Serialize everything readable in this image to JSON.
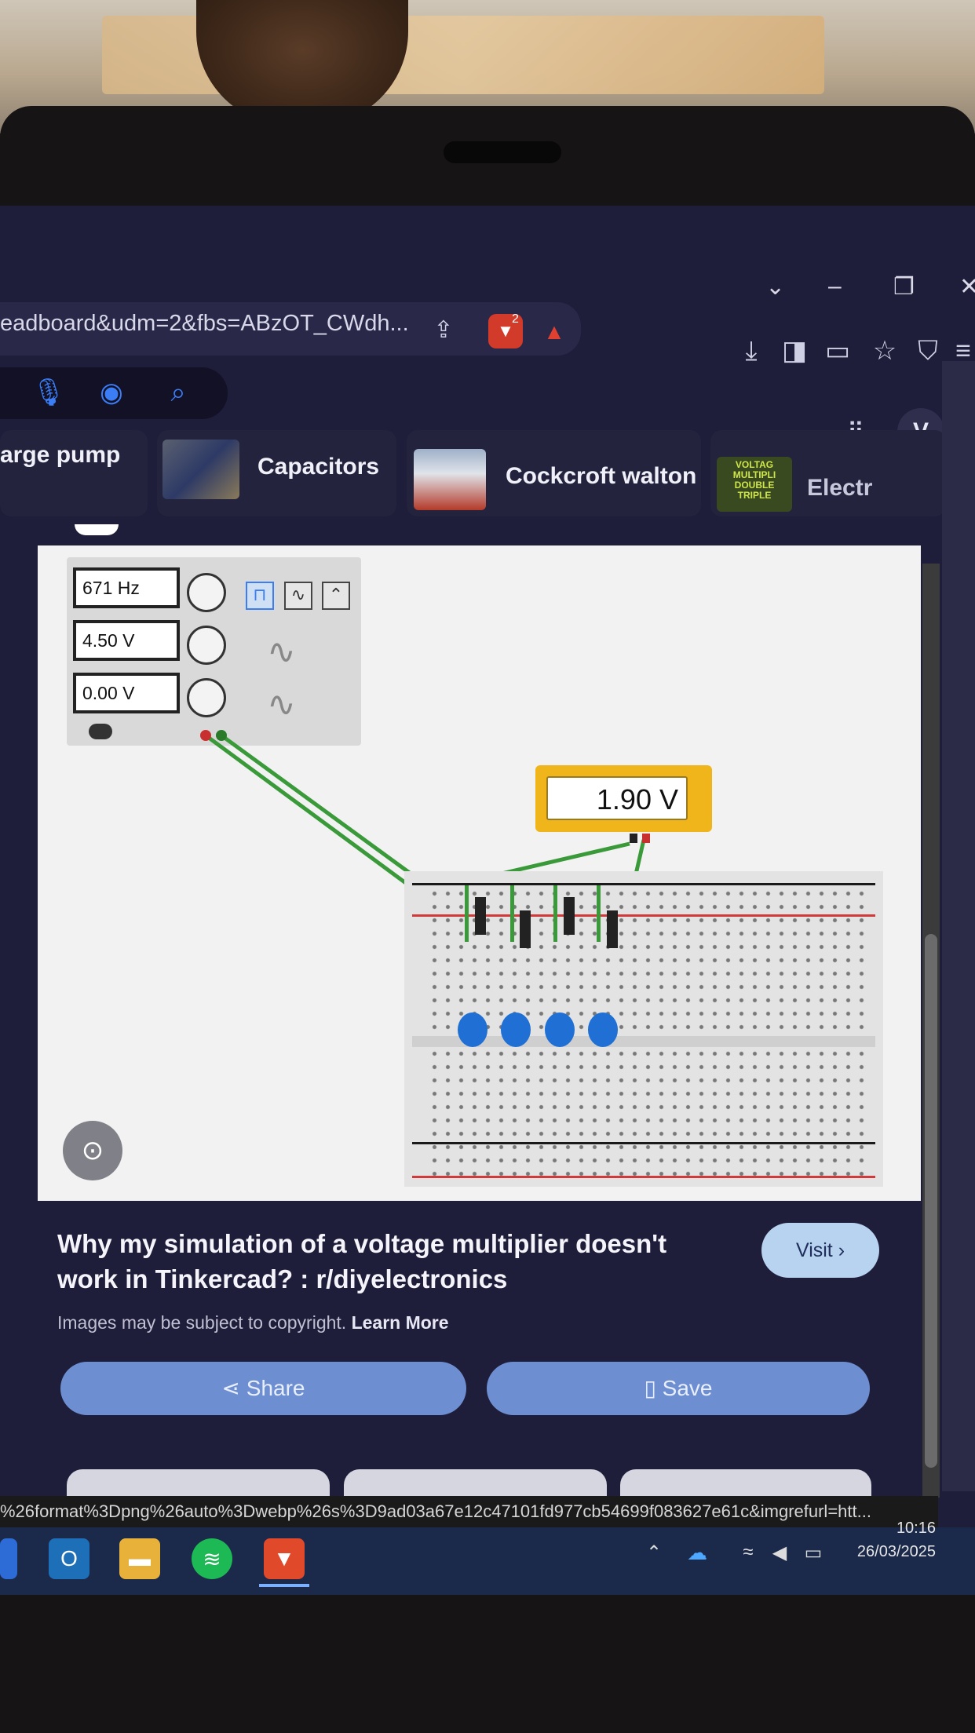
{
  "browser": {
    "url_text": "eadboard&udm=2&fbs=ABzOT_CWdh...",
    "shield_badge": "2",
    "profile_initial": "V",
    "status_url": "%26format%3Dpng%26auto%3Dwebp%26s%3D9ad03a67e12c47101fd977cb54699f083627e61c&imgrefurl=htt..."
  },
  "chips": [
    {
      "label": "arge pump"
    },
    {
      "label": "Capacitors"
    },
    {
      "label": "Cockcroft walton"
    },
    {
      "label": "Electr"
    }
  ],
  "chip_thumbnail_texts": [
    "VOLTAG",
    "MULTIPLI",
    "DOUBLE",
    "TRIPLE"
  ],
  "simulation": {
    "fg_frequency": "671 Hz",
    "fg_amplitude": "4.50 V",
    "fg_offset": "0.00 V",
    "multimeter_reading": "1.90 V"
  },
  "result": {
    "title": "Why my simulation of a voltage multiplier doesn't work in Tinkercad? : r/diyelectronics",
    "copyright_text": "Images may be subject to copyright.",
    "learn_more": "Learn More",
    "visit_label": "Visit",
    "share_label": "Share",
    "save_label": "Save"
  },
  "taskbar": {
    "time": "10:16",
    "date": "26/03/2025"
  },
  "colors": {
    "screen_bg": "#1e1d3a",
    "accent_blue": "#6d8fd1",
    "multimeter_yellow": "#f0b51b",
    "wire_green": "#3a9a3a",
    "capacitor_blue": "#1f6fd4"
  }
}
